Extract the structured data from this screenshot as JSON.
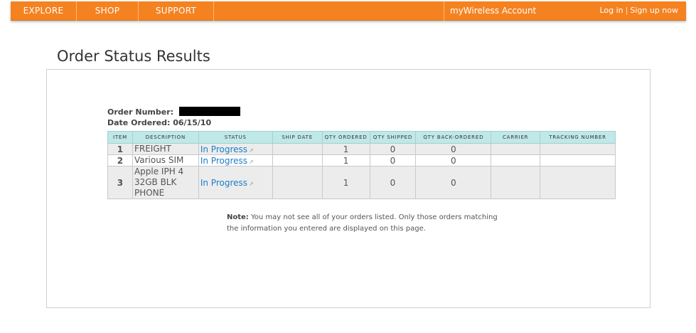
{
  "nav": {
    "items": [
      {
        "label": "EXPLORE"
      },
      {
        "label": "SHOP"
      },
      {
        "label": "SUPPORT"
      }
    ],
    "account_label": "myWireless Account",
    "login_label": "Log in",
    "separator": "|",
    "signup_label": "Sign up now"
  },
  "page": {
    "title": "Order Status Results"
  },
  "order": {
    "number_label": "Order Number:",
    "date_label": "Date Ordered:",
    "date_value": "06/15/10"
  },
  "table": {
    "headers": [
      "ITEM",
      "DESCRIPTION",
      "STATUS",
      "SHIP DATE",
      "QTY ORDERED",
      "QTY SHIPPED",
      "QTY BACK-ORDERED",
      "CARRIER",
      "TRACKING NUMBER"
    ],
    "rows": [
      {
        "item": "1",
        "description": "FREIGHT",
        "status": "In Progress",
        "ship_date": "",
        "qty_ordered": "1",
        "qty_shipped": "0",
        "qty_backordered": "0",
        "carrier": "",
        "tracking": ""
      },
      {
        "item": "2",
        "description": "Various SIM",
        "status": "In Progress",
        "ship_date": "",
        "qty_ordered": "1",
        "qty_shipped": "0",
        "qty_backordered": "0",
        "carrier": "",
        "tracking": ""
      },
      {
        "item": "3",
        "description": "Apple IPH 4 32GB BLK PHONE",
        "status": "In Progress",
        "ship_date": "",
        "qty_ordered": "1",
        "qty_shipped": "0",
        "qty_backordered": "0",
        "carrier": "",
        "tracking": ""
      }
    ],
    "external_link_glyph": "↗"
  },
  "note": {
    "label": "Note:",
    "text": "You may not see all of your orders listed. Only those orders matching the information you entered are displayed on this page."
  },
  "colors": {
    "nav_orange": "#f58220",
    "header_teal": "#bfe8e8",
    "link_blue": "#1a7ec9"
  }
}
